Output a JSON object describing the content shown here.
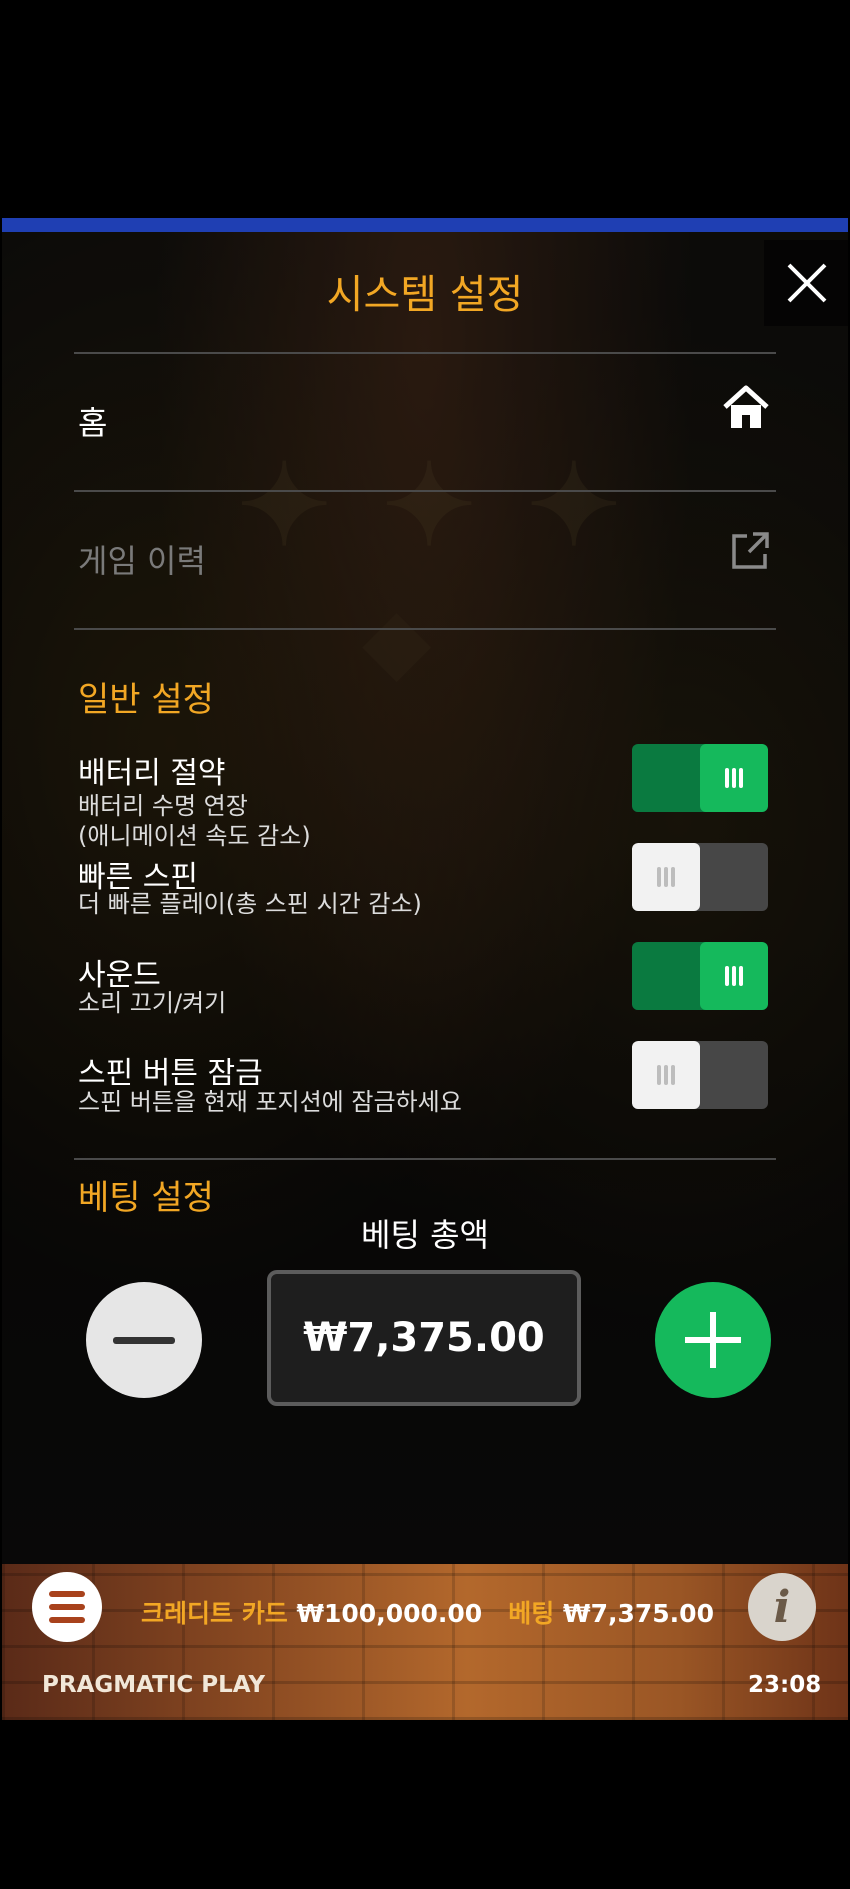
{
  "dialog": {
    "title": "시스템 설정",
    "home_label": "홈",
    "history_label": "게임 이력"
  },
  "general": {
    "section_title": "일반 설정",
    "settings": [
      {
        "name": "배터리 절약",
        "desc": "배터리 수명 연장\n(애니메이션 속도 감소)",
        "on": true
      },
      {
        "name": "빠른 스핀",
        "desc": "더 빠른 플레이(총 스핀 시간 감소)",
        "on": false
      },
      {
        "name": "사운드",
        "desc": "소리 끄기/켜기",
        "on": true
      },
      {
        "name": "스핀 버튼 잠금",
        "desc": "스핀 버튼을 현재 포지션에 잠금하세요",
        "on": false
      }
    ]
  },
  "bet": {
    "section_title": "베팅 설정",
    "total_label": "베팅 총액",
    "total_value": "₩7,375.00"
  },
  "footer": {
    "credit_label": "크레디트 카드",
    "credit_value": "₩100,000.00",
    "bet_label": "베팅",
    "bet_value": "₩7,375.00",
    "brand": "PRAGMATIC PLAY",
    "time": "23:08"
  },
  "icons": {
    "close": "close-icon",
    "home": "home-icon",
    "history": "external-link-icon",
    "menu": "hamburger-menu-icon",
    "info": "info-icon"
  },
  "colors": {
    "accent": "#f2a724",
    "toggle_on": "#15b95c",
    "toggle_track_on": "#0a7a40",
    "toggle_off": "#474747"
  }
}
